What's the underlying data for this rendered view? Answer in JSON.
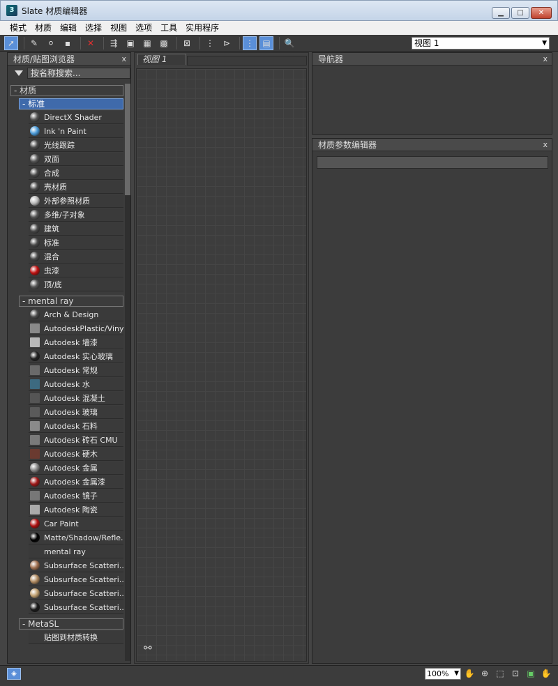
{
  "window": {
    "title": "Slate 材质编辑器",
    "icon": "3ds-max-icon"
  },
  "menu": [
    "模式",
    "材质",
    "编辑",
    "选择",
    "视图",
    "选项",
    "工具",
    "实用程序"
  ],
  "view_select": {
    "value": "视图 1"
  },
  "browser": {
    "title": "材质/贴图浏览器",
    "search_placeholder": "按名称搜索...",
    "group_materials": "- 材质",
    "sub_standard": "- 标准",
    "standard_items": [
      {
        "label": "DirectX Shader",
        "swatch": "#555555"
      },
      {
        "label": "Ink 'n Paint",
        "swatch": "#4a9ad8"
      },
      {
        "label": "光线跟踪",
        "swatch": "#4a4a4a"
      },
      {
        "label": "双面",
        "swatch": "#555555"
      },
      {
        "label": "合成",
        "swatch": "#4a4a4a"
      },
      {
        "label": "壳材质",
        "swatch": "#4a4a4a"
      },
      {
        "label": "外部参照材质",
        "swatch": "#bbbbbb"
      },
      {
        "label": "多维/子对象",
        "swatch": "#555555"
      },
      {
        "label": "建筑",
        "swatch": "#4a4a4a"
      },
      {
        "label": "标准",
        "swatch": "#4a4a4a"
      },
      {
        "label": "混合",
        "swatch": "#4a4a4a"
      },
      {
        "label": "虫漆",
        "swatch": "#c01010"
      },
      {
        "label": "顶/底",
        "swatch": "#555555"
      }
    ],
    "sub_mentalray": "- mental ray",
    "mentalray_items": [
      {
        "label": "Arch & Design",
        "swatch": "#4a4a4a",
        "sq": false
      },
      {
        "label": "AutodeskPlastic/Vinyl",
        "swatch": "#8a8a8a",
        "sq": true
      },
      {
        "label": "Autodesk 墙漆",
        "swatch": "#b8b8b8",
        "sq": true
      },
      {
        "label": "Autodesk 实心玻璃",
        "swatch": "#222222",
        "sq": false
      },
      {
        "label": "Autodesk 常规",
        "swatch": "#6a6a6a",
        "sq": true
      },
      {
        "label": "Autodesk 水",
        "swatch": "#3d6a80",
        "sq": true
      },
      {
        "label": "Autodesk 混凝土",
        "swatch": "#555555",
        "sq": true
      },
      {
        "label": "Autodesk 玻璃",
        "swatch": "#5a5a5a",
        "sq": true
      },
      {
        "label": "Autodesk 石料",
        "swatch": "#8a8a8a",
        "sq": true
      },
      {
        "label": "Autodesk 砖石 CMU",
        "swatch": "#7a7a7a",
        "sq": true
      },
      {
        "label": "Autodesk 硬木",
        "swatch": "#6a3a30",
        "sq": true
      },
      {
        "label": "Autodesk 金属",
        "swatch": "#888888",
        "sq": false
      },
      {
        "label": "Autodesk 金属漆",
        "swatch": "#a01818",
        "sq": false
      },
      {
        "label": "Autodesk 镜子",
        "swatch": "#777777",
        "sq": true
      },
      {
        "label": "Autodesk 陶瓷",
        "swatch": "#aaaaaa",
        "sq": true
      },
      {
        "label": "Car Paint",
        "swatch": "#b01010",
        "sq": false
      },
      {
        "label": "Matte/Shadow/Refle...",
        "swatch": "#000000",
        "sq": false
      },
      {
        "label": "mental ray",
        "swatch": "#3a3a3a",
        "sq": true
      },
      {
        "label": "Subsurface Scatteri...",
        "swatch": "#a07050",
        "sq": false
      },
      {
        "label": "Subsurface Scatteri...",
        "swatch": "#b08a60",
        "sq": false
      },
      {
        "label": "Subsurface Scatteri...",
        "swatch": "#c0a070",
        "sq": false
      },
      {
        "label": "Subsurface Scatteri...",
        "swatch": "#1a1a1a",
        "sq": false
      }
    ],
    "sub_metasl": "- MetaSL",
    "metasl_items": [
      {
        "label": "贴图到材质转换",
        "swatch": "#3a3a3a",
        "sq": true
      }
    ],
    "close": "x"
  },
  "view": {
    "tab": "视图 1"
  },
  "navigator": {
    "title": "导航器",
    "close": "x"
  },
  "params": {
    "title": "材质参数编辑器",
    "close": "x"
  },
  "status": {
    "zoom": "100%"
  }
}
